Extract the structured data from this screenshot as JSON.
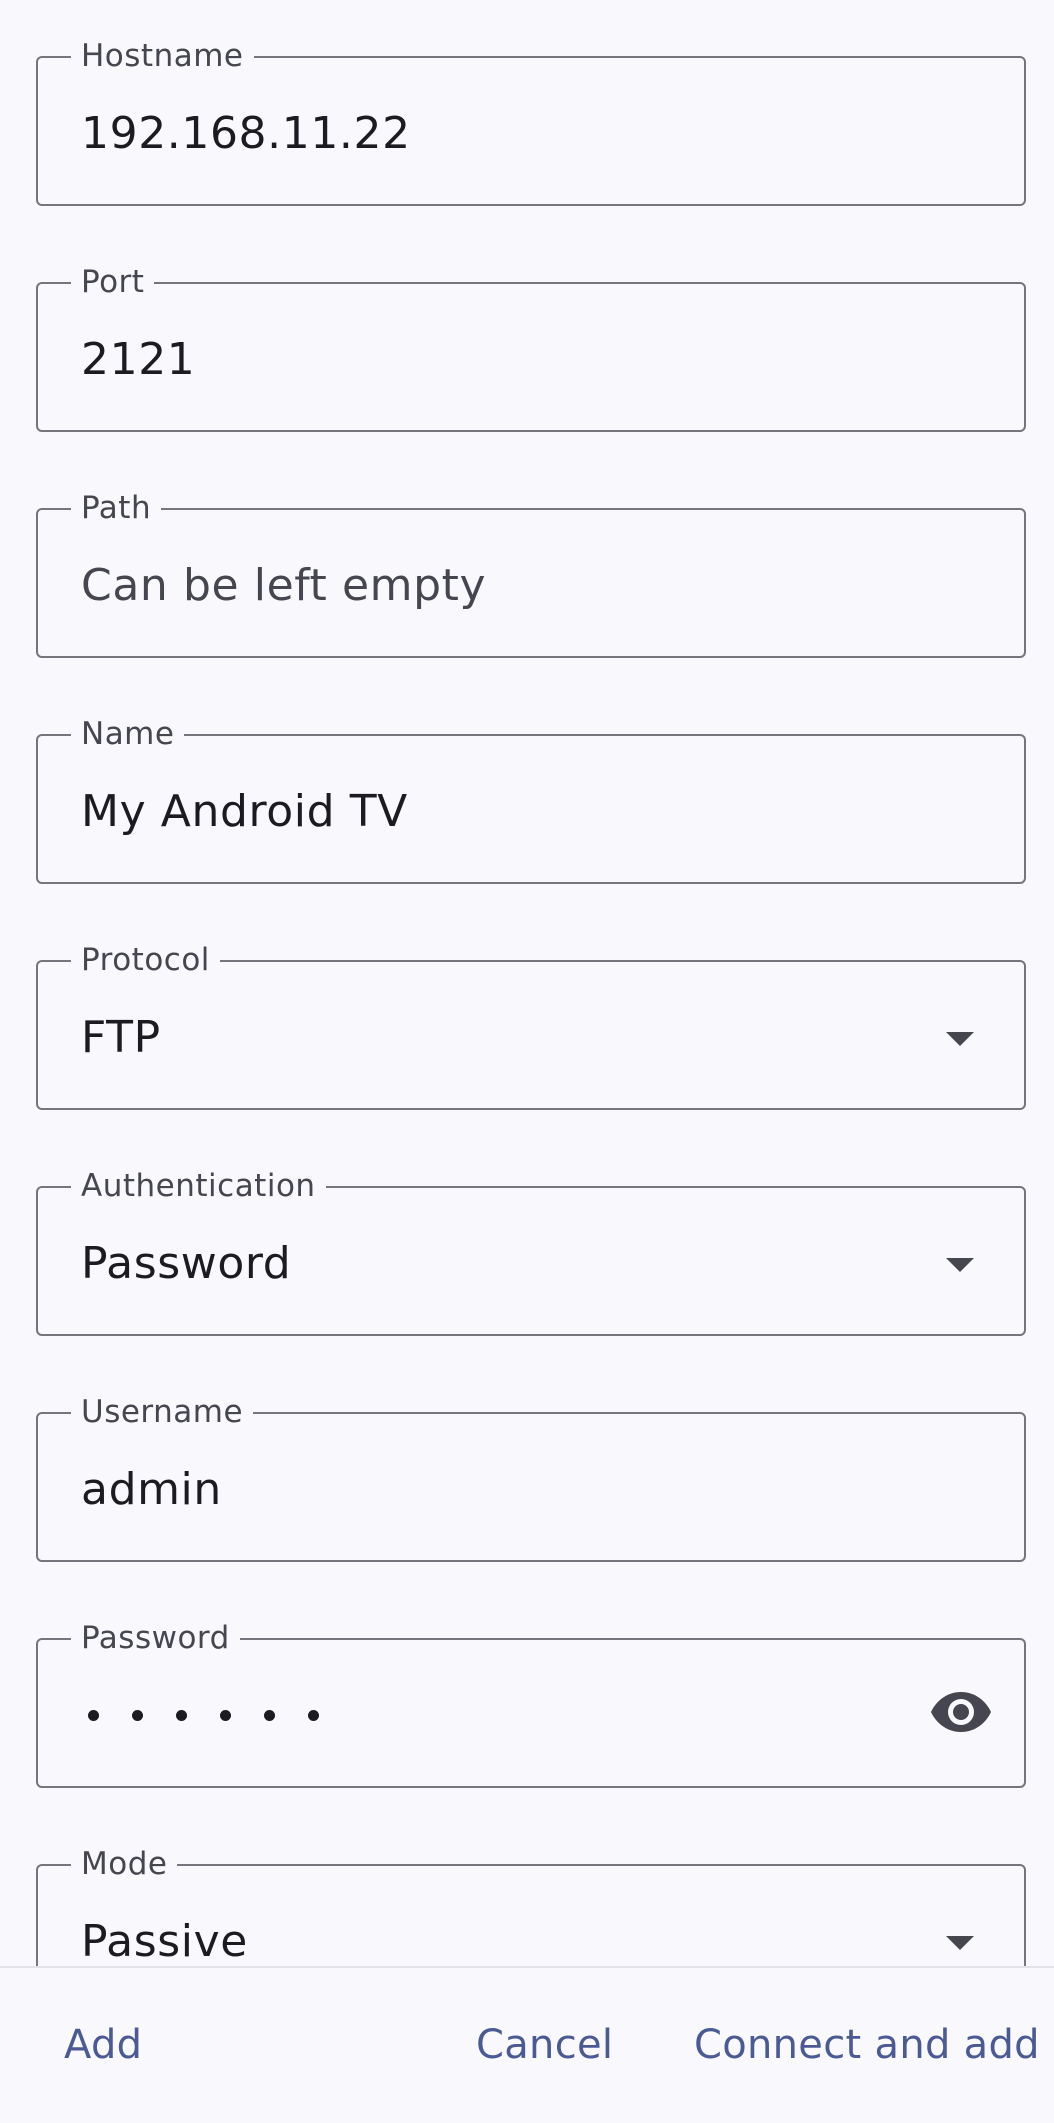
{
  "fields": {
    "hostname": {
      "label": "Hostname",
      "value": "192.168.11.22"
    },
    "port": {
      "label": "Port",
      "value": "2121"
    },
    "path": {
      "label": "Path",
      "placeholder": "Can be left empty"
    },
    "name": {
      "label": "Name",
      "value": "My Android TV"
    },
    "protocol": {
      "label": "Protocol",
      "value": "FTP"
    },
    "authentication": {
      "label": "Authentication",
      "value": "Password"
    },
    "username": {
      "label": "Username",
      "value": "admin"
    },
    "password": {
      "label": "Password",
      "masked_length": 6,
      "icon": "eye-icon"
    },
    "mode": {
      "label": "Mode",
      "value": "Passive"
    }
  },
  "actions": {
    "add": "Add",
    "cancel": "Cancel",
    "connect_and_add": "Connect and add"
  },
  "colors": {
    "background": "#f8f8fd",
    "outline": "#75767d",
    "label": "#45464f",
    "text": "#1b1b21",
    "accent": "#4a5a94"
  }
}
